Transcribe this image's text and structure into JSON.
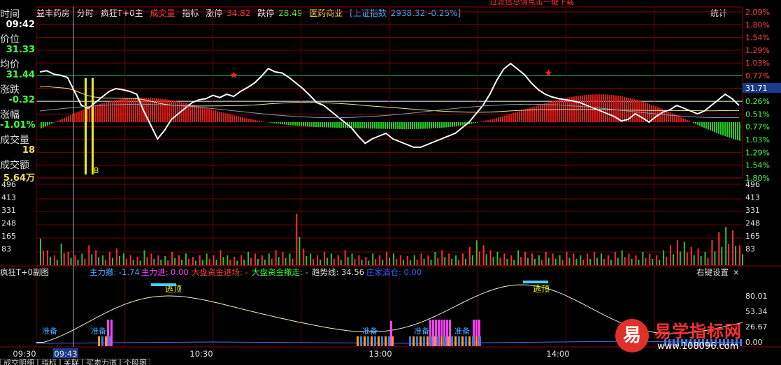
{
  "topbar": {
    "warning": "过滤信息请点击一键下载"
  },
  "header": {
    "stock_name": "益丰药房",
    "view": "分时",
    "indicator": "疯狂T+0主",
    "volume_label": "成交量",
    "indicator_label": "指标",
    "limit_up_label": "涨停",
    "limit_up_value": "34.82",
    "limit_down_label": "跌停",
    "limit_down_value": "28.49",
    "sector": "医药商业",
    "index_name": "[上证指数",
    "index_value": "2938.32 -0.25%]",
    "stats_label": "统计"
  },
  "left_panel": {
    "time_label": "时间",
    "time_value": "09:42",
    "price_label": "价位",
    "price_value": "31.33",
    "avg_label": "均价",
    "avg_value": "31.44",
    "change_label": "涨跌",
    "change_value": "-0.32",
    "pct_label": "涨幅",
    "pct_value": "-1.01%",
    "vol_label": "成交量",
    "vol_value": "18",
    "amount_label": "成交额",
    "amount_value": "5.64万"
  },
  "right_axis_price": [
    "2.09%",
    "1.80%",
    "1.54%",
    "1.29%",
    "1.03%",
    "0.77%",
    "0.51%",
    "0.26%",
    "0.51%",
    "0.77%",
    "1.03%",
    "1.29%",
    "1.54%",
    "1.80%"
  ],
  "current_price_tag": "31.71",
  "volume_axis": [
    "496",
    "413",
    "331",
    "248",
    "165",
    "83"
  ],
  "sub_header": {
    "title": "疯狂T+0副图",
    "main_out": "主力撤: -1.74",
    "main_in": "主力进: 0.00",
    "market_in": "大盘资金进场: -",
    "market_out": "大盘资金撤走: -",
    "trend": "趋势线: 34.56",
    "clear": "庄家清仓: 0.00",
    "settings": "右键设置",
    "close": "×"
  },
  "sub_axis": [
    "80.01",
    "53.34",
    "26.67",
    "0.00"
  ],
  "sub_annotations": {
    "flee": "逃顶",
    "prepare": "准备",
    "buy": "B"
  },
  "time_axis": [
    "09:30",
    "09:43",
    "10:30",
    "13:00",
    "14:00"
  ],
  "tabs": [
    "成交明细",
    "指标",
    "关联",
    "买卖力道",
    "个股图"
  ],
  "logo": {
    "glyph": "易",
    "title": "易学指标网",
    "url": "www.108096.com"
  },
  "colors": {
    "up": "#ff2020",
    "down": "#22cc22",
    "grid": "#8b0000",
    "price_line": "#ffffff",
    "avg_line": "#f0e68c"
  },
  "chart_data": {
    "type": "line",
    "price_series": [
      0.9,
      0.92,
      0.86,
      0.84,
      0.8,
      0.55,
      0.3,
      0.25,
      0.35,
      0.45,
      0.55,
      0.6,
      0.58,
      0.55,
      0.5,
      0.2,
      -0.05,
      -0.3,
      -0.15,
      0.05,
      0.15,
      0.25,
      0.35,
      0.4,
      0.42,
      0.48,
      0.44,
      0.5,
      0.46,
      0.55,
      0.62,
      0.7,
      0.82,
      0.96,
      0.9,
      0.88,
      0.8,
      0.7,
      0.6,
      0.48,
      0.35,
      0.3,
      0.2,
      0.1,
      0.0,
      -0.1,
      -0.25,
      -0.38,
      -0.3,
      -0.25,
      -0.2,
      -0.3,
      -0.35,
      -0.4,
      -0.45,
      -0.45,
      -0.4,
      -0.35,
      -0.3,
      -0.25,
      -0.2,
      -0.1,
      0.0,
      0.15,
      0.3,
      0.5,
      0.75,
      0.95,
      1.05,
      0.95,
      0.85,
      0.7,
      0.58,
      0.5,
      0.45,
      0.42,
      0.4,
      0.38,
      0.35,
      0.3,
      0.25,
      0.2,
      0.15,
      0.1,
      0.02,
      0.05,
      0.15,
      0.08,
      0.0,
      0.1,
      0.18,
      0.22,
      0.3,
      0.25,
      0.2,
      0.15,
      0.2,
      0.3,
      0.4,
      0.5,
      0.42,
      0.3
    ],
    "volume_series": [
      160,
      90,
      60,
      130,
      80,
      60,
      70,
      120,
      90,
      60,
      80,
      100,
      70,
      60,
      50,
      90,
      70,
      60,
      55,
      80,
      60,
      70,
      50,
      60,
      70,
      60,
      90,
      60,
      50,
      60,
      80,
      70,
      60,
      70,
      90,
      80,
      70,
      310,
      100,
      70,
      60,
      80,
      70,
      60,
      90,
      70,
      60,
      50,
      70,
      60,
      80,
      70,
      60,
      55,
      60,
      70,
      60,
      80,
      90,
      70,
      60,
      70,
      110,
      150,
      120,
      90,
      80,
      70,
      60,
      90,
      80,
      70,
      60,
      80,
      70,
      60,
      80,
      70,
      60,
      70,
      80,
      70,
      60,
      80,
      90,
      70,
      60,
      80,
      70,
      60,
      90,
      120,
      150,
      140,
      110,
      100,
      80,
      150,
      200,
      230,
      210,
      120
    ]
  }
}
